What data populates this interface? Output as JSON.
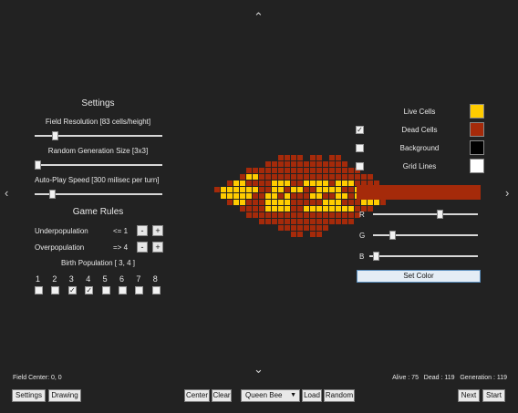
{
  "settings": {
    "title": "Settings",
    "field_resolution_label": "Field Resolution [83 cells/height]",
    "random_gen_label": "Random Generation Size [3x3]",
    "autoplay_label": "Auto-Play Speed [300 milisec per turn]"
  },
  "rules": {
    "title": "Game Rules",
    "under_label": "Underpopulation",
    "under_value": "<= 1",
    "over_label": "Overpopulation",
    "over_value": "=> 4",
    "minus": "-",
    "plus": "+",
    "birth_label": "Birth Population [ 3, 4 ]",
    "birth_numbers": [
      "1",
      "2",
      "3",
      "4",
      "5",
      "6",
      "7",
      "8"
    ],
    "birth_checked": [
      false,
      false,
      true,
      true,
      false,
      false,
      false,
      false
    ]
  },
  "colors_panel": {
    "live_label": "Live Cells",
    "dead_label": "Dead Cells",
    "background_label": "Background",
    "grid_label": "Grid Lines",
    "r_label": "R",
    "g_label": "G",
    "b_label": "B",
    "set_color_label": "Set Color",
    "live_color": "#FFCC00",
    "dead_color": "#A52A0A",
    "background_color": "#000000",
    "grid_color": "#FFFFFF",
    "selected_color": "#A52A0A",
    "dead_checked": true,
    "background_checked": false,
    "grid_checked": false,
    "r_value": 165,
    "g_value": 42,
    "b_value": 10
  },
  "bottom": {
    "field_center": "Field Center: 0, 0",
    "stats": "Alive : 75   Dead : 119   Generation : 119",
    "settings_btn": "Settings",
    "drawing_btn": "Drawing",
    "center_btn": "Center",
    "clear_btn": "Clear",
    "pattern_selected": "Queen Bee",
    "load_btn": "Load",
    "random_btn": "Random",
    "next_btn": "Next",
    "start_btn": "Start"
  },
  "slider_levels": {
    "field_resolution": 0.18,
    "random_generation": 0.0,
    "autoplay_speed": 0.16
  },
  "icons": {
    "up": "chevron-up-icon",
    "down": "chevron-down-icon",
    "left": "chevron-left-icon",
    "right": "chevron-right-icon"
  }
}
